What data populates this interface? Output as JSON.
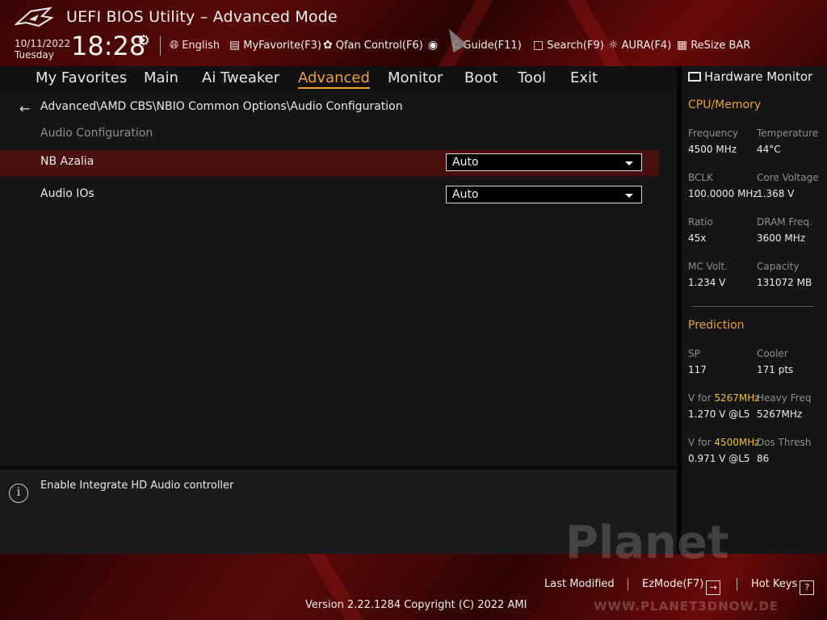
{
  "header": {
    "title": "UEFI BIOS Utility – Advanced Mode",
    "date": "10/11/2022",
    "day": "Tuesday",
    "time": "18:28",
    "topnav": [
      {
        "icon": "globe-icon",
        "label": "English"
      },
      {
        "icon": "myfavorite-icon",
        "label": "MyFavorite(F3)"
      },
      {
        "icon": "fan-icon",
        "label": "Qfan Control(F6)"
      },
      {
        "icon": "oc-guide-icon",
        "label": "C Guide(F11)"
      },
      {
        "icon": "search-icon",
        "label": "Search(F9)"
      },
      {
        "icon": "aura-icon",
        "label": "AURA(F4)"
      },
      {
        "icon": "resize-bar-icon",
        "label": "ReSize BAR"
      }
    ]
  },
  "menu": {
    "items": [
      "My Favorites",
      "Main",
      "Ai Tweaker",
      "Advanced",
      "Monitor",
      "Boot",
      "Tool",
      "Exit"
    ],
    "active": "Advanced"
  },
  "main": {
    "breadcrumb": "Advanced\\AMD CBS\\NBIO Common Options\\Audio Configuration",
    "section_title": "Audio Configuration",
    "settings": [
      {
        "label": "NB Azalia",
        "value": "Auto",
        "selected": true
      },
      {
        "label": "Audio IOs",
        "value": "Auto",
        "selected": false
      }
    ]
  },
  "help": {
    "text": "Enable Integrate HD Audio controller"
  },
  "hardware_monitor": {
    "title": "Hardware Monitor",
    "cpu_memory": {
      "heading": "CPU/Memory",
      "frequency_label": "Frequency",
      "frequency": "4500 MHz",
      "temperature_label": "Temperature",
      "temperature": "44°C",
      "bclk_label": "BCLK",
      "bclk": "100.0000 MHz",
      "core_voltage_label": "Core Voltage",
      "core_voltage": "1.368 V",
      "ratio_label": "Ratio",
      "ratio": "45x",
      "dram_freq_label": "DRAM Freq.",
      "dram_freq": "3600 MHz",
      "mc_volt_label": "MC Volt.",
      "mc_volt": "1.234 V",
      "capacity_label": "Capacity",
      "capacity": "131072 MB"
    },
    "prediction": {
      "heading": "Prediction",
      "sp_label": "SP",
      "sp": "117",
      "cooler_label": "Cooler",
      "cooler": "171 pts",
      "vfor1_prefix": "V for ",
      "vfor1_freq": "5267MHz",
      "vfor1_value": "1.270 V @L5",
      "heavy_freq_label": "Heavy Freq",
      "heavy_freq": "5267MHz",
      "vfor2_prefix": "V for ",
      "vfor2_freq": "4500MHz",
      "vfor2_value": "0.971 V @L5",
      "dos_thresh_label": "Dos Thresh",
      "dos_thresh": "86"
    }
  },
  "footer": {
    "last_modified": "Last Modified",
    "ezmode": "EzMode(F7)",
    "ezmode_key": "→",
    "hot_keys": "Hot Keys",
    "hot_keys_key": "?",
    "version": "Version 2.22.1284 Copyright (C) 2022 AMI",
    "watermark": "Planet",
    "watermark_url": "WWW.PLANET3DNOW.DE"
  },
  "colors": {
    "accent": "#f0a030",
    "highlight_row": "#4a1010",
    "prediction_freq": "#f0c020"
  }
}
